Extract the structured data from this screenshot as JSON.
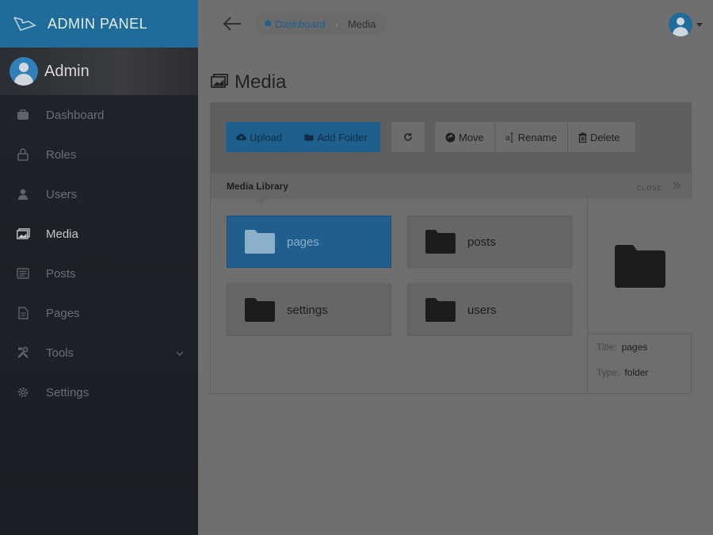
{
  "brand": {
    "title": "ADMIN PANEL"
  },
  "user": {
    "name": "Admin"
  },
  "sidebar": {
    "items": [
      {
        "label": "Dashboard",
        "icon": "dashboard-icon",
        "active": false
      },
      {
        "label": "Roles",
        "icon": "lock-icon",
        "active": false
      },
      {
        "label": "Users",
        "icon": "person-icon",
        "active": false
      },
      {
        "label": "Media",
        "icon": "images-icon",
        "active": true
      },
      {
        "label": "Posts",
        "icon": "news-icon",
        "active": false
      },
      {
        "label": "Pages",
        "icon": "file-icon",
        "active": false
      },
      {
        "label": "Tools",
        "icon": "tools-icon",
        "active": false,
        "has_submenu": true
      },
      {
        "label": "Settings",
        "icon": "gear-icon",
        "active": false
      }
    ]
  },
  "breadcrumb": {
    "home": "Dashboard",
    "current": "Media"
  },
  "page": {
    "title": "Media"
  },
  "toolbar": {
    "upload": "Upload",
    "add_folder": "Add Folder",
    "move": "Move",
    "rename": "Rename",
    "delete": "Delete"
  },
  "library": {
    "label": "Media Library",
    "close": "CLOSE"
  },
  "folders": [
    {
      "name": "pages",
      "selected": true
    },
    {
      "name": "posts",
      "selected": false
    },
    {
      "name": "settings",
      "selected": false
    },
    {
      "name": "users",
      "selected": false
    }
  ],
  "details": {
    "title_label": "Title:",
    "title_value": "pages",
    "type_label": "Type:",
    "type_value": "folder"
  },
  "colors": {
    "brand": "#1f6b99",
    "accent": "#1f5f8e",
    "sidebar": "#1b1e24"
  }
}
